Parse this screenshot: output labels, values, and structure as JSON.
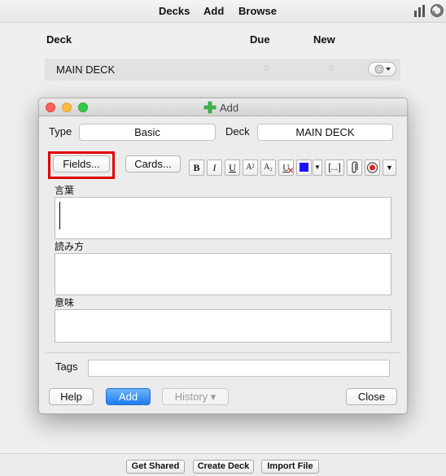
{
  "topbar": {
    "decks_label": "Decks",
    "add_label": "Add",
    "browse_label": "Browse"
  },
  "deck_list": {
    "headers": {
      "deck": "Deck",
      "due": "Due",
      "new": "New"
    },
    "rows": [
      {
        "name": "MAIN DECK",
        "due": "0",
        "new": "0"
      }
    ]
  },
  "bottombar": {
    "get_shared_label": "Get Shared",
    "create_deck_label": "Create Deck",
    "import_file_label": "Import File"
  },
  "add_dialog": {
    "title": "Add",
    "type_label": "Type",
    "type_value": "Basic",
    "deck_label": "Deck",
    "deck_value": "MAIN DECK",
    "fields_button": "Fields...",
    "cards_button": "Cards...",
    "toolbar": {
      "bold": "B",
      "italic": "I",
      "underline": "U",
      "superscript": "A²",
      "subscript": "A₂",
      "clear_format": "U",
      "cloze": "[...]",
      "text_color": "#1f14ff"
    },
    "fields": [
      {
        "label": "言葉",
        "value": ""
      },
      {
        "label": "読み方",
        "value": ""
      },
      {
        "label": "意味",
        "value": ""
      }
    ],
    "tags_label": "Tags",
    "tags_value": "",
    "help_button": "Help",
    "add_button": "Add",
    "history_button": "History ▾",
    "close_button": "Close"
  },
  "colors": {
    "accent_blue": "#1e7cf1",
    "highlight_red": "#e00000",
    "add_plus_green": "#3cb44a"
  }
}
